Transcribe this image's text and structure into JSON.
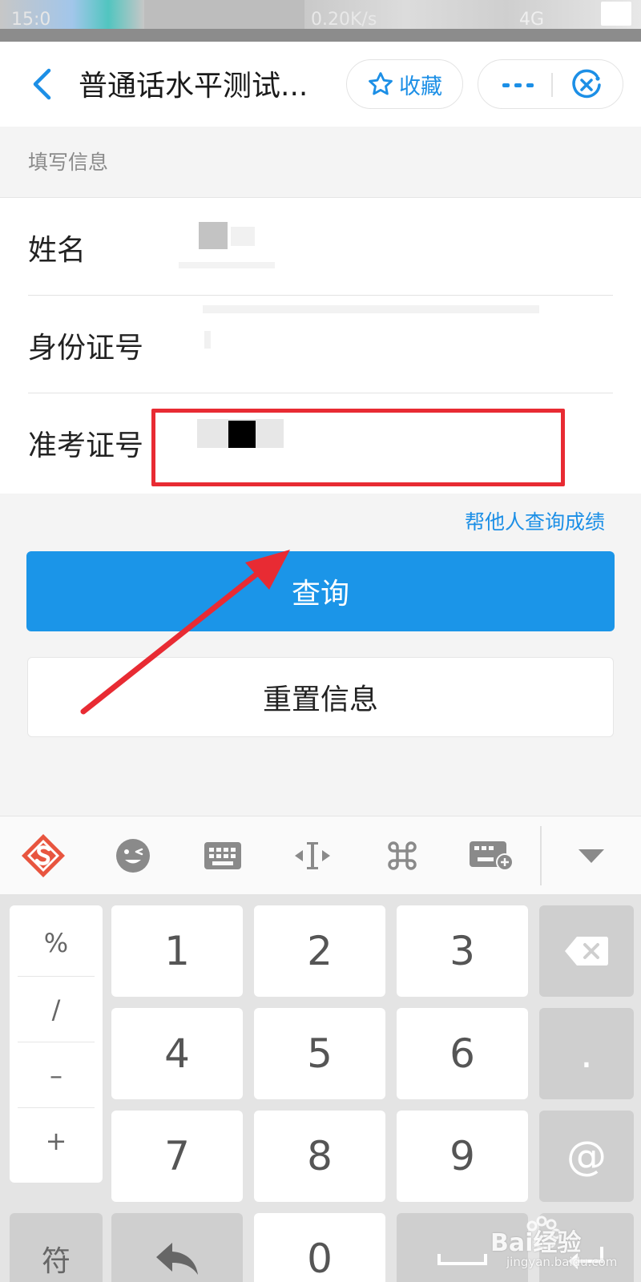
{
  "status_bar": {
    "time": "15:0",
    "network_speed": "0.20K/s",
    "network_type": "4G"
  },
  "navbar": {
    "title": "普通话水平测试...",
    "favorite_label": "收藏"
  },
  "form": {
    "section_label": "填写信息",
    "fields": [
      {
        "label": "姓名",
        "value": ""
      },
      {
        "label": "身份证号",
        "value": ""
      },
      {
        "label": "准考证号",
        "value": ""
      }
    ]
  },
  "actions": {
    "help_link": "帮他人查询成绩",
    "query_label": "查询",
    "reset_label": "重置信息"
  },
  "keyboard": {
    "symbols": [
      "%",
      "/",
      "–",
      "+"
    ],
    "digits": [
      "1",
      "2",
      "3",
      "4",
      "5",
      "6",
      "7",
      "8",
      "9",
      "0"
    ],
    "dot": ".",
    "at": "@",
    "sym_label": "符"
  },
  "watermark": {
    "brand": "Bai经验",
    "url": "jingyan.baidu.com"
  },
  "colors": {
    "accent": "#1b95e8",
    "highlight": "#e82b33"
  }
}
